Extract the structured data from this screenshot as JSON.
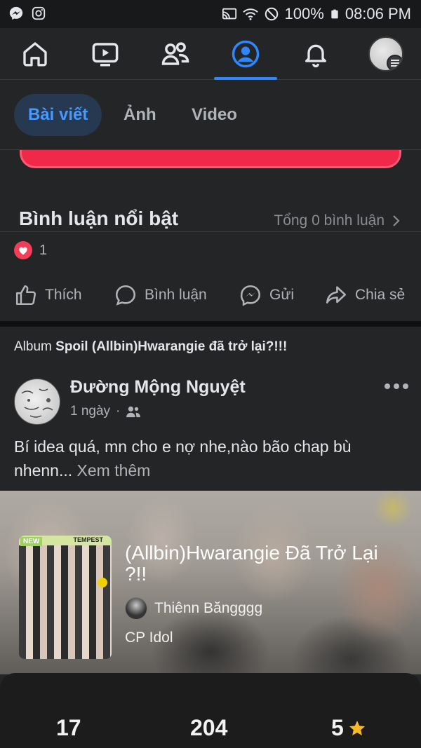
{
  "status_bar": {
    "battery": "100%",
    "time": "08:06 PM",
    "left_icons": [
      "messenger-icon",
      "instagram-icon"
    ],
    "right_icons": [
      "cast-icon",
      "wifi-icon",
      "do-not-disturb-icon",
      "battery-icon"
    ]
  },
  "nav": {
    "items": [
      "home-icon",
      "watch-icon",
      "friends-icon",
      "profile-icon",
      "bell-icon",
      "menu-avatar"
    ],
    "active": "profile-icon",
    "accent": "#2d88ff"
  },
  "tabs": [
    {
      "label": "Bài viết",
      "active": true
    },
    {
      "label": "Ảnh",
      "active": false
    },
    {
      "label": "Video",
      "active": false
    }
  ],
  "highlight": {
    "title": "Bình luận nổi bật",
    "total": "Tổng 0 bình luận"
  },
  "reactions": {
    "count": "1"
  },
  "actions": {
    "like": "Thích",
    "comment": "Bình luận",
    "send": "Gửi",
    "share": "Chia sẻ"
  },
  "album": {
    "prefix": "Album",
    "name": "Spoil (Allbin)Hwarangie đã trở lại?!!!"
  },
  "post": {
    "author": "Đường Mộng Nguyệt",
    "time": "1 ngày",
    "text": "Bí idea quá, mn cho e nợ nhe,nào bão chap bù nhenn...",
    "see_more": "Xem thêm"
  },
  "story": {
    "cover_badge": "NEW",
    "cover_brand": "TEMPEST",
    "title": "(Allbin)Hwarangie Đã Trở Lại ?!!",
    "author": "Thiênn Băngggg",
    "category": "CP Idol"
  },
  "stats": {
    "parts": "17",
    "reads": "204",
    "rating": "5"
  }
}
